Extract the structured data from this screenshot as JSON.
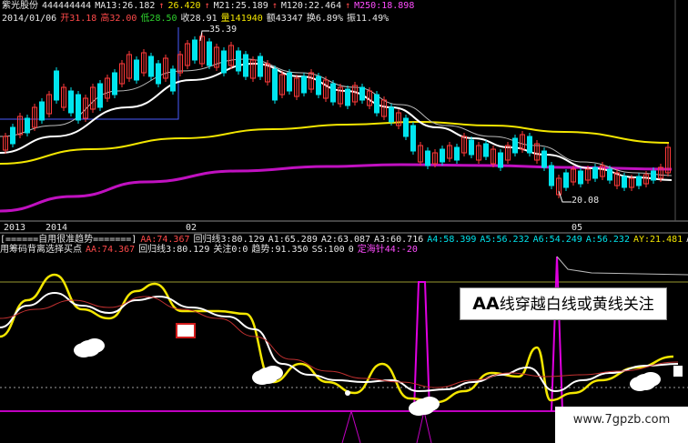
{
  "stock": {
    "name": "紫光股份",
    "code": "444444444",
    "ma13": "MA13:26.182",
    "ma13_arrow": "↑",
    "ma13_b": "26.420",
    "m21": "M21:25.189",
    "m120": "M120:22.464",
    "m250": "M250:18.898",
    "date": "2014/01/06",
    "open": "开31.18",
    "high": "高32.00",
    "low": "低28.50",
    "close": "收28.91",
    "vol": "量141940",
    "amount": "额43347",
    "turnover": "换6.89%",
    "amplitude": "振11.49%"
  },
  "price_labels": {
    "high_mark": "35.39",
    "low_mark": "20.08"
  },
  "axis_labels": {
    "y2013": "2013",
    "y2014": "2014",
    "m02": "02",
    "m05": "05"
  },
  "sub_header1": {
    "title": "[======自用很准趋势=======]",
    "aa": "AA:74.367",
    "hgx": "回归线3:80.129",
    "a1": "A1:65.289",
    "a2": "A2:63.087",
    "a3": "A3:60.716",
    "a4": "A4:58.399",
    "a5": "A5:56.232",
    "a6": "A6:54.249",
    "a_": "A:56.232",
    "ay": "AY:21.481",
    "ay2": "AY"
  },
  "sub_header2": {
    "title": "用筹码背离选择买点",
    "aa": "AA:74.367",
    "hgx": "回归线3:80.129",
    "focus": "关注0:0",
    "trend": "趋势:91.350",
    "ss": "SS:100",
    "zero": "0",
    "dhz": "定海针44:-20"
  },
  "callout": {
    "bold": "AA",
    "text": "线穿越白线或黄线关注"
  },
  "watermark": "www.7gpzb.com",
  "colors": {
    "up": "#ff3a3a",
    "down": "#00e5ee",
    "yellow": "#f3e600",
    "white": "#e8e8e8",
    "magenta": "#d000d0",
    "bluebox": "#4a5cff"
  }
}
